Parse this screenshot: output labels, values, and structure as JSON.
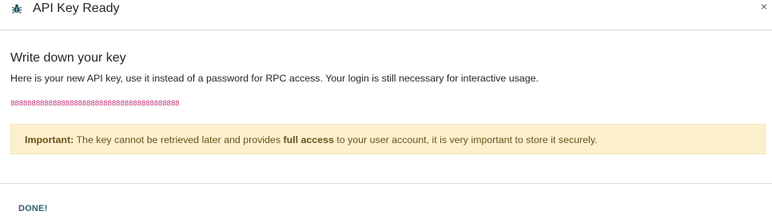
{
  "dialog": {
    "title": "API Key Ready",
    "title_icon": "bug-icon",
    "close_glyph": "×"
  },
  "body": {
    "heading": "Write down your key",
    "description": "Here is your new API key, use it instead of a password for RPC access. Your login is still necessary for interactive usage.",
    "api_key": "8888888888888888888888888888888888888888"
  },
  "alert": {
    "prefix": "Important:",
    "text_before": " The key cannot be retrieved later and provides ",
    "emphasis": "full access",
    "text_after": " to your user account, it is very important to store it securely.",
    "background_color": "#fdf0cf",
    "text_color": "#6b5319"
  },
  "footer": {
    "done_label": "DONE!"
  },
  "colors": {
    "key_color": "#c0357a",
    "done_color": "#2f5f74"
  }
}
